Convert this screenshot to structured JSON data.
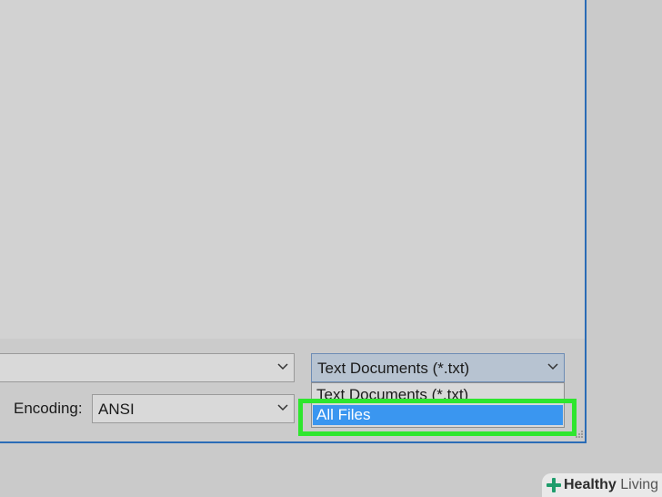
{
  "save_dialog": {
    "filename_value": "",
    "filetype_selected": "Text Documents (*.txt)",
    "encoding_label": "Encoding:",
    "encoding_value": "ANSI",
    "filetype_options": [
      "Text Documents (*.txt)",
      "All Files"
    ],
    "highlighted_option": "All Files"
  },
  "watermark": {
    "brand_bold": "Healthy",
    "brand_light": "Living"
  },
  "colors": {
    "selection": "#3a96f0",
    "highlight_box": "#2ee62e",
    "dialog_border": "#2b6cb6"
  }
}
